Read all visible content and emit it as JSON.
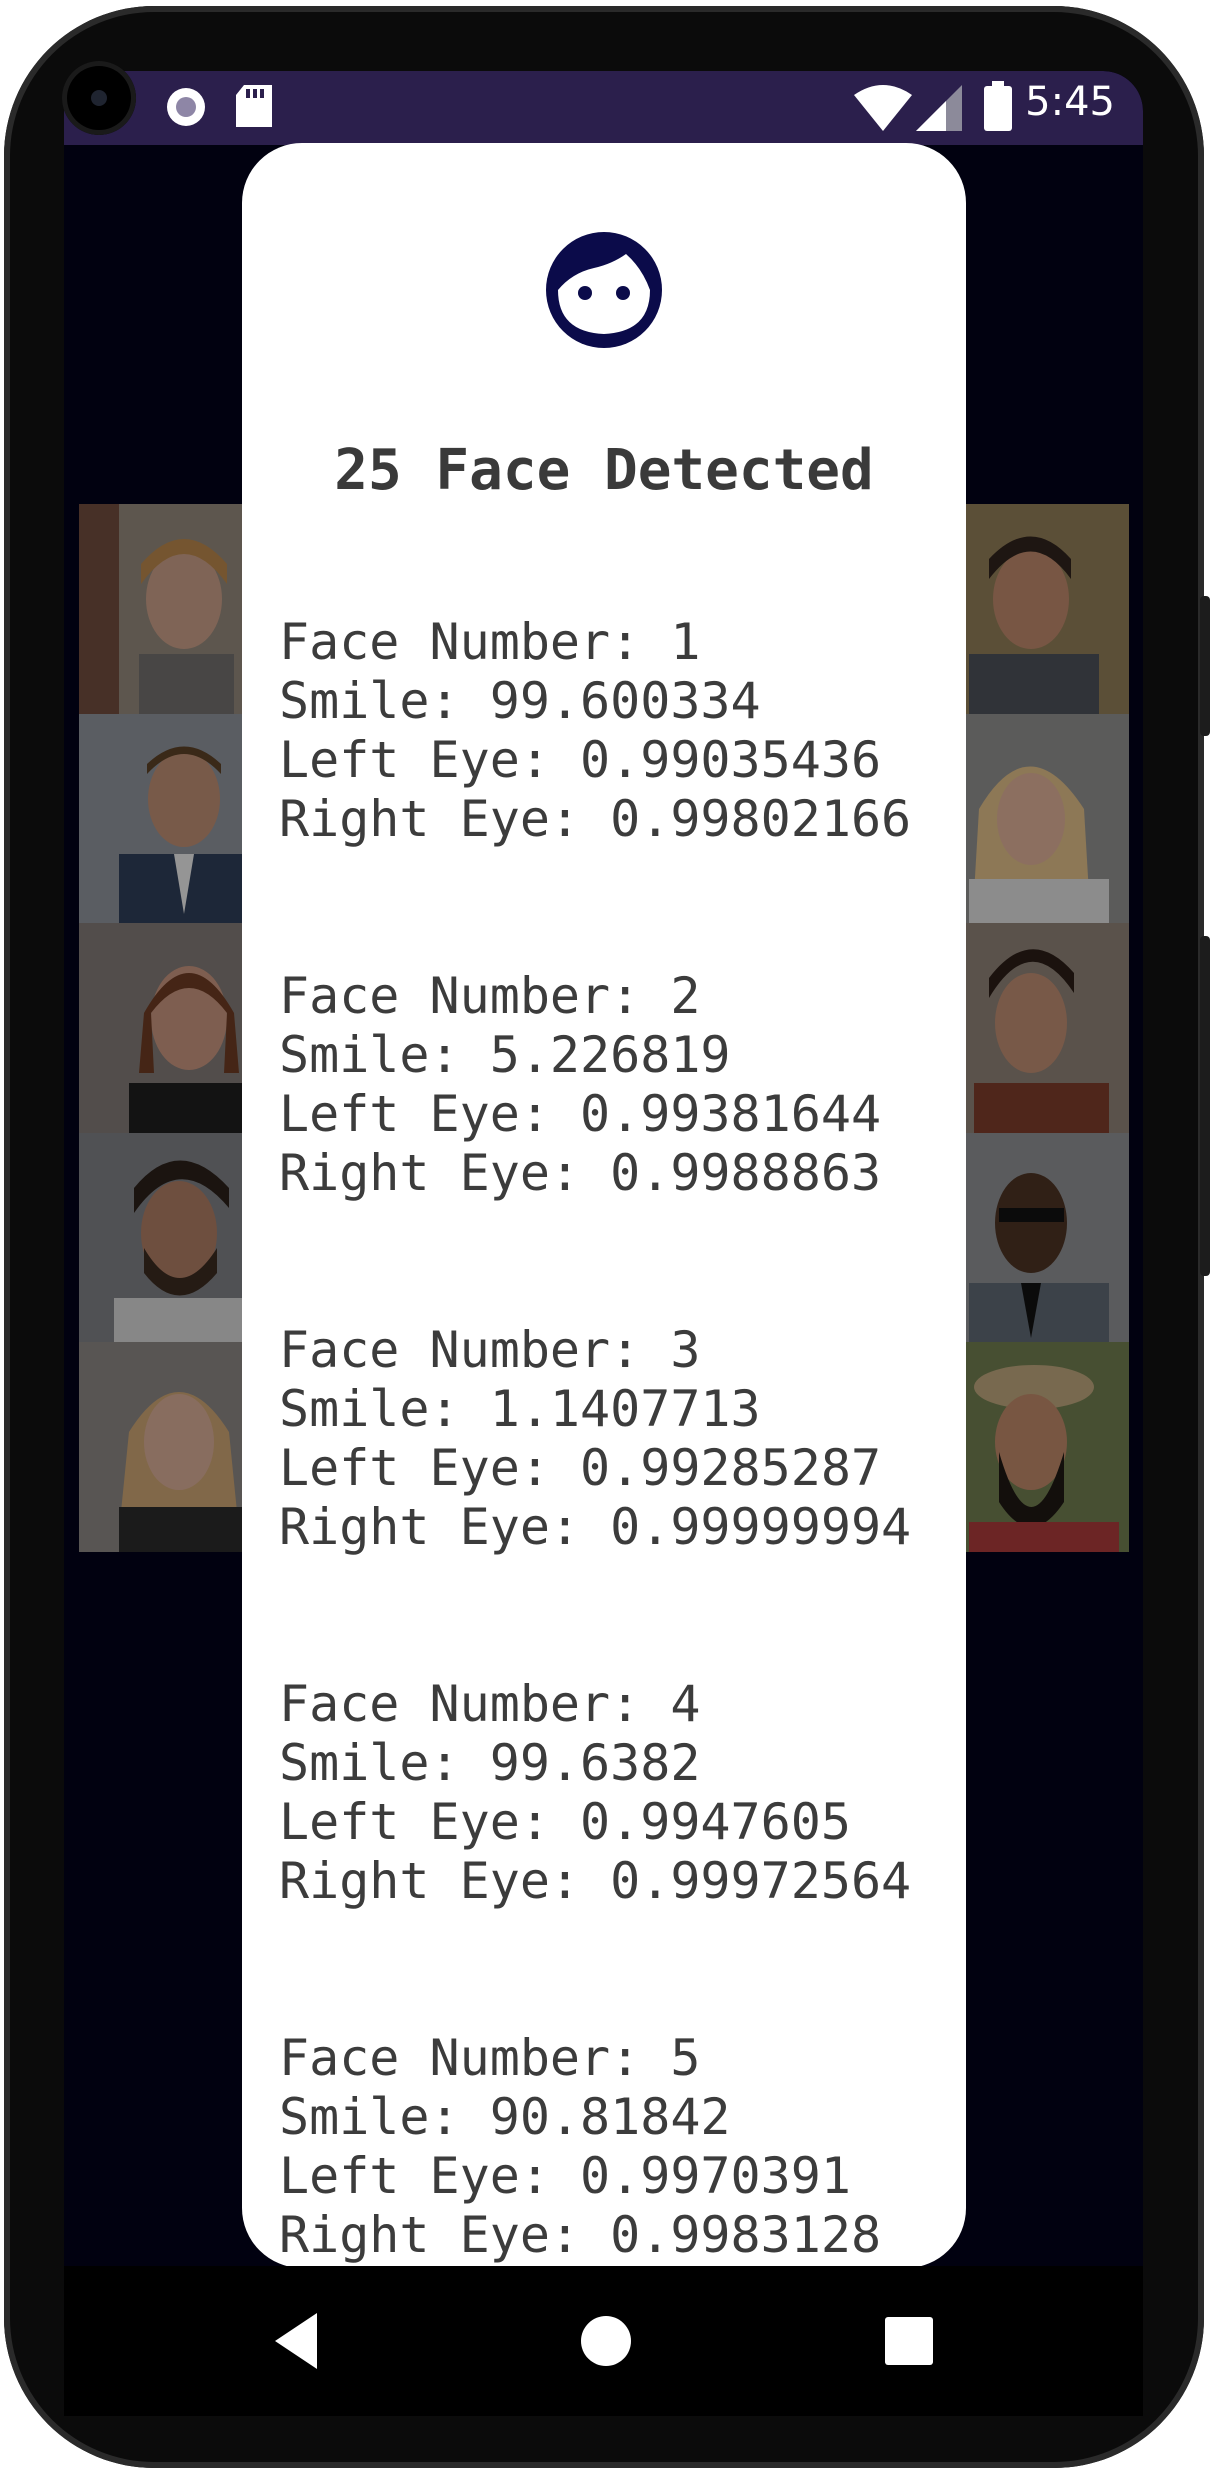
{
  "status_bar": {
    "time": "5:45",
    "left_icons": [
      "check-icon",
      "circle-record-icon",
      "sd-card-icon"
    ],
    "right_icons": [
      "wifi-icon",
      "signal-icon",
      "battery-icon"
    ]
  },
  "dialog": {
    "icon": "face-icon",
    "icon_color": "#0b0b4a",
    "title": "25 Face Detected",
    "faces": [
      {
        "number": "Face Number: 1",
        "smile": "Smile: 99.600334",
        "left_eye": "Left Eye: 0.99035436",
        "right_eye": "Right Eye: 0.99802166"
      },
      {
        "number": "Face Number: 2",
        "smile": "Smile: 5.226819",
        "left_eye": "Left Eye: 0.99381644",
        "right_eye": "Right Eye: 0.9988863"
      },
      {
        "number": "Face Number: 3",
        "smile": "Smile: 1.1407713",
        "left_eye": "Left Eye: 0.99285287",
        "right_eye": "Right Eye: 0.99999994"
      },
      {
        "number": "Face Number: 4",
        "smile": "Smile: 99.6382",
        "left_eye": "Left Eye: 0.9947605",
        "right_eye": "Right Eye: 0.99972564"
      },
      {
        "number": "Face Number: 5",
        "smile": "Smile: 90.81842",
        "left_eye": "Left Eye: 0.9970391",
        "right_eye": "Right Eye: 0.9983128"
      }
    ]
  },
  "nav_bar": {
    "buttons": [
      "back-icon",
      "home-icon",
      "recents-icon"
    ]
  },
  "colors": {
    "status_bar_bg": "#2b1f4c",
    "screen_bg": "#03031a",
    "text": "#3c3c3c"
  }
}
